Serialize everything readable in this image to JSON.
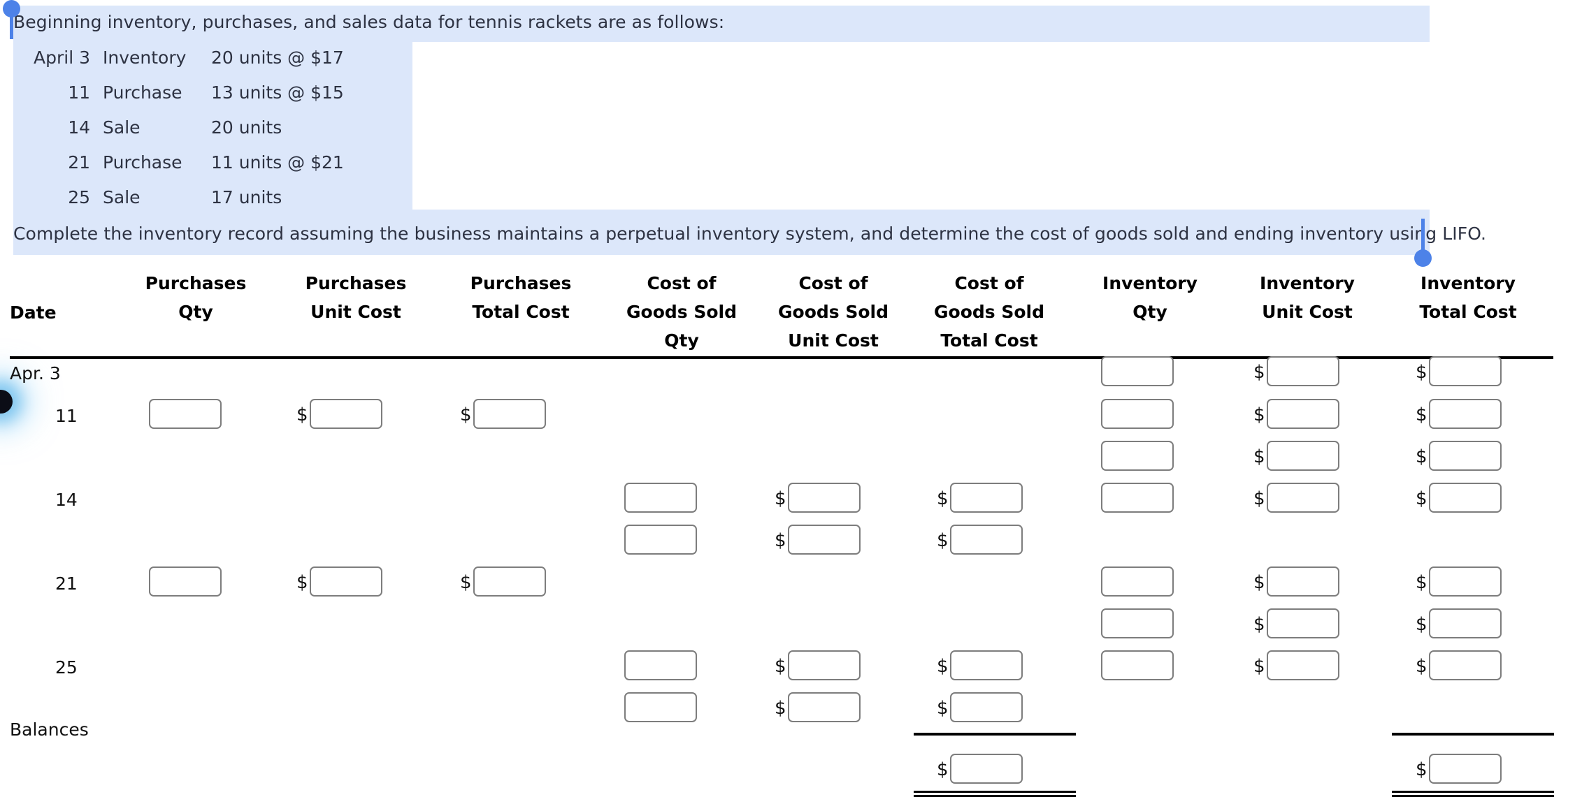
{
  "problem": {
    "intro": "Beginning inventory, purchases, and sales data for tennis rackets are as follows:",
    "closing": "Complete the inventory record assuming the business maintains a perpetual inventory system, and determine the cost of goods sold and ending inventory using LIFO.",
    "data_rows": [
      {
        "date": "April 3",
        "type": "Inventory",
        "desc": "20 units @ $17"
      },
      {
        "date": "11",
        "type": "Purchase",
        "desc": "13 units @ $15"
      },
      {
        "date": "14",
        "type": "Sale",
        "desc": "20 units"
      },
      {
        "date": "21",
        "type": "Purchase",
        "desc": "11 units @ $21"
      },
      {
        "date": "25",
        "type": "Sale",
        "desc": "17 units"
      }
    ]
  },
  "selection": {
    "highlight_color": "#dce7fa",
    "handle_color": "#4d82e8"
  },
  "table": {
    "headers": [
      {
        "line1": "",
        "line2": "",
        "line3": "Date"
      },
      {
        "line1": "",
        "line2": "Purchases",
        "line3": "Qty"
      },
      {
        "line1": "",
        "line2": "Purchases",
        "line3": "Unit Cost"
      },
      {
        "line1": "",
        "line2": "Purchases",
        "line3": "Total Cost"
      },
      {
        "line1": "Cost of",
        "line2": "Goods Sold",
        "line3": "Qty"
      },
      {
        "line1": "Cost of",
        "line2": "Goods Sold",
        "line3": "Unit Cost"
      },
      {
        "line1": "Cost of",
        "line2": "Goods Sold",
        "line3": "Total Cost"
      },
      {
        "line1": "",
        "line2": "Inventory",
        "line3": "Qty"
      },
      {
        "line1": "",
        "line2": "Inventory",
        "line3": "Unit Cost"
      },
      {
        "line1": "",
        "line2": "Inventory",
        "line3": "Total Cost"
      }
    ],
    "dates": {
      "apr3": "Apr. 3",
      "d11": "11",
      "d14": "14",
      "d21": "21",
      "d25": "25",
      "balances": "Balances"
    },
    "currency_symbol": "$",
    "input_value": "",
    "input_placeholder": ""
  }
}
